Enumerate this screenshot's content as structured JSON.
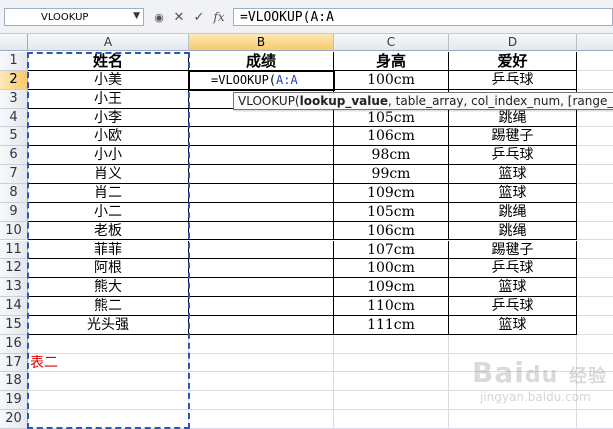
{
  "namebox": "VLOOKUP",
  "formula_buttons": {
    "cancel": "✕",
    "enter": "✓",
    "fx": "fx"
  },
  "formula_text": "=VLOOKUP(A:A",
  "columns": [
    "A",
    "B",
    "C",
    "D"
  ],
  "rows": [
    "1",
    "2",
    "3",
    "4",
    "5",
    "6",
    "7",
    "8",
    "9",
    "10",
    "11",
    "12",
    "13",
    "14",
    "15",
    "16",
    "17",
    "18",
    "19",
    "20"
  ],
  "headers": {
    "a": "姓名",
    "b": "成绩",
    "c": "身高",
    "d": "爱好"
  },
  "table": [
    {
      "name": "小美",
      "height": "100cm",
      "hobby": "乒乓球"
    },
    {
      "name": "小王",
      "height": "",
      "hobby": ""
    },
    {
      "name": "小李",
      "height": "105cm",
      "hobby": "跳绳"
    },
    {
      "name": "小欧",
      "height": "106cm",
      "hobby": "踢毽子"
    },
    {
      "name": "小小",
      "height": "98cm",
      "hobby": "乒乓球"
    },
    {
      "name": "肖义",
      "height": "99cm",
      "hobby": "篮球"
    },
    {
      "name": "肖二",
      "height": "109cm",
      "hobby": "篮球"
    },
    {
      "name": "小二",
      "height": "105cm",
      "hobby": "跳绳"
    },
    {
      "name": "老板",
      "height": "106cm",
      "hobby": "跳绳"
    },
    {
      "name": "菲菲",
      "height": "107cm",
      "hobby": "踢毽子"
    },
    {
      "name": "阿根",
      "height": "100cm",
      "hobby": "乒乓球"
    },
    {
      "name": "熊大",
      "height": "109cm",
      "hobby": "篮球"
    },
    {
      "name": "熊二",
      "height": "110cm",
      "hobby": "乒乓球"
    },
    {
      "name": "光头强",
      "height": "111cm",
      "hobby": "篮球"
    }
  ],
  "editing_cell": {
    "prefix": "=VLOOKUP(",
    "ref": "A:A"
  },
  "table2_label": "表二",
  "tooltip": {
    "fn": "VLOOKUP(",
    "arg1": "lookup_value",
    "rest": ", table_array, col_index_num, [range_lookup])"
  },
  "watermark": "Baidu经验",
  "watermark_sub": "jingyan.baidu.com",
  "colors": {
    "marquee": "#2b55b8",
    "selected_header": "#f9c86b",
    "red_text": "#e00000"
  }
}
